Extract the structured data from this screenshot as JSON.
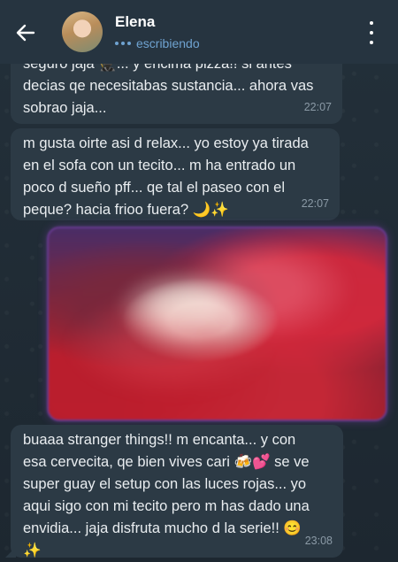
{
  "header": {
    "contact_name": "Elena",
    "status": "escribiendo"
  },
  "messages": [
    {
      "text": "seguro jaja 🥷... y encima pizza!! si antes\ndecias qe necesitabas sustancia... ahora vas\nsobrao jaja...",
      "time": "22:07"
    },
    {
      "text": "m gusta oirte asi d relax... yo estoy ya tirada\nen el sofa con un tecito... m ha entrado un\npoco d sueño pff... qe tal el paseo con el\npeque? hacia frioo fuera? 🌙✨",
      "time": "22:07"
    },
    {
      "text": "buaaa stranger things!! m encanta... y con\nesa cervecita, qe bien vives cari 🍻💕 se ve\nsuper guay el setup con las luces rojas... yo\naqui sigo con mi tecito pero m has dado una\nenvidia... jaja disfruta mucho d la serie!! 😊\n✨",
      "time": "23:08"
    }
  ],
  "colors": {
    "header_bg": "#263440",
    "bubble_bg": "#2c3a45",
    "status_blue": "#6fa3d1",
    "media_border": "#6b3b93"
  }
}
